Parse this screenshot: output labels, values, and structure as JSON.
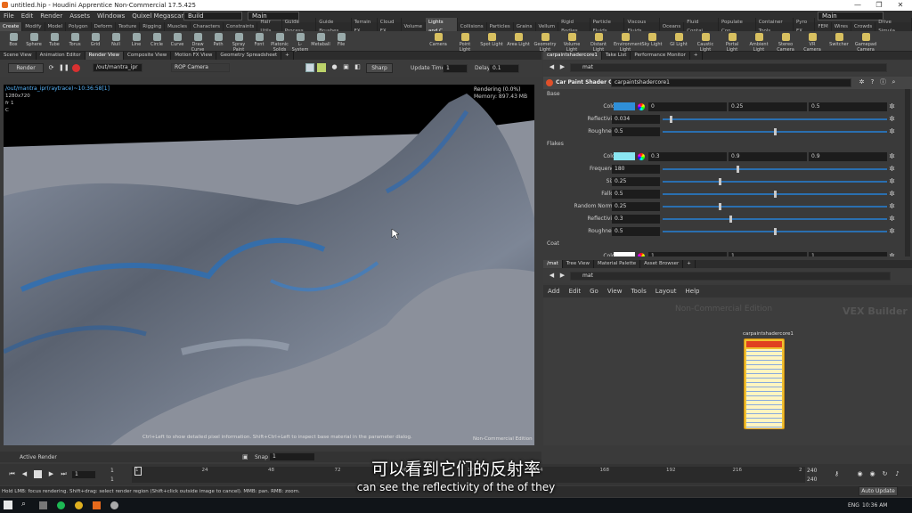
{
  "window": {
    "title": "untitled.hip - Houdini Apprentice Non-Commercial 17.5.425",
    "min": "—",
    "max": "❐",
    "close": "✕"
  },
  "menu": [
    "File",
    "Edit",
    "Render",
    "Assets",
    "Windows",
    "Quixel Megascans",
    "Help"
  ],
  "desktop_combo": "Build",
  "main_combo": "Main",
  "right_main_combo": "Main",
  "shelf_tabs_left": [
    "Create",
    "Modify",
    "Model",
    "Polygon",
    "Deform",
    "Texture",
    "Rigging",
    "Muscles",
    "Characters",
    "Constraints",
    "Hair Utils",
    "Guide Process",
    "Guide Brushes",
    "Terrain FX",
    "Cloud FX",
    "Volume"
  ],
  "shelf_tabs_right": [
    "Lights and C",
    "Collisions",
    "Particles",
    "Grains",
    "Vellum",
    "Rigid Bodies",
    "Particle Fluids",
    "Viscous Fluids",
    "Oceans",
    "Fluid Contai...",
    "Populate Con...",
    "Container Tools",
    "Pyro FX",
    "FEM",
    "Wires",
    "Crowds",
    "Drive Simula..."
  ],
  "shelf_tools_left": [
    "Box",
    "Sphere",
    "Tube",
    "Torus",
    "Grid",
    "Null",
    "Line",
    "Circle",
    "Curve",
    "Draw Curve",
    "Path",
    "Spray Paint",
    "Font",
    "Platonic Solids",
    "L-System",
    "Metaball",
    "File"
  ],
  "shelf_tools_right": [
    "Camera",
    "Point Light",
    "Spot Light",
    "Area Light",
    "Geometry Light",
    "Volume Light",
    "Distant Light",
    "Environment Light",
    "Sky Light",
    "GI Light",
    "Caustic Light",
    "Portal Light",
    "Ambient Light",
    "Stereo Camera",
    "VR Camera",
    "Switcher",
    "Gamepad Camera"
  ],
  "left_pane_tabs": [
    "Scene View",
    "Animation Editor",
    "Render View",
    "Composite View",
    "Motion FX View",
    "Geometry Spreadsheet"
  ],
  "render_toolbar": {
    "render_btn": "Render",
    "path": "/out/mantra_ipr",
    "camera": "ROP Camera",
    "sharp": "Sharp",
    "update_label": "Update Time",
    "update_value": "1",
    "delay_label": "Delay",
    "delay_value": "0.1"
  },
  "render_info": {
    "path": "/out/mantra_ipr(raytrace)~10:36:58[1]",
    "res": "1280x720",
    "frame": "fr 1",
    "channel": "C",
    "status": "Rendering (0.0%)",
    "memory": "Memory:   897.43 MB",
    "hint": "Ctrl+Left to show detailed pixel information. Shift+Ctrl+Left to inspect base material in the parameter dialog.",
    "edition": "Non-Commercial Edition"
  },
  "right_top_tabs": [
    "carpaintshadercore1",
    "Take List",
    "Performance Monitor"
  ],
  "param_path": "mat",
  "param_header": {
    "type": "Car Paint Shader Core",
    "name": "carpaintshadercore1"
  },
  "base_section": "Base",
  "base_params": [
    {
      "label": "Color",
      "v1": "0",
      "v2": "0.25",
      "v3": "0.5",
      "swatch": "#2f8fd8"
    },
    {
      "label": "Reflectivity",
      "value": "0.034",
      "knob": 0.03
    },
    {
      "label": "Roughness",
      "value": "0.5",
      "knob": 0.5
    }
  ],
  "flakes_section": "Flakes",
  "flake_params": [
    {
      "label": "Color",
      "v1": "0.3",
      "v2": "0.9",
      "v3": "0.9",
      "swatch": "#8ae6f2"
    },
    {
      "label": "Frequency",
      "value": "180",
      "knob": 0.33
    },
    {
      "label": "Size",
      "value": "0.25",
      "knob": 0.25
    },
    {
      "label": "Falloff",
      "value": "0.5",
      "knob": 0.5
    },
    {
      "label": "Random Normal",
      "value": "0.25",
      "knob": 0.25
    },
    {
      "label": "Reflectivity",
      "value": "0.3",
      "knob": 0.3
    },
    {
      "label": "Roughness",
      "value": "0.5",
      "knob": 0.5
    }
  ],
  "coat_section": "Coat",
  "coat_params": [
    {
      "label": "Color",
      "v1": "1",
      "v2": "1",
      "v3": "1"
    }
  ],
  "network_tabs": [
    "/mat",
    "Tree View",
    "Material Palette",
    "Asset Browser"
  ],
  "network_path": "mat",
  "network_menu": [
    "Add",
    "Edit",
    "Go",
    "View",
    "Tools",
    "Layout",
    "Help"
  ],
  "network_watermark": "Non-Commercial Edition",
  "network_context": "VEX Builder",
  "node_name": "carpaintshadercore1",
  "timeline": {
    "frame": "1",
    "ticks": [
      "1",
      "24",
      "48",
      "72",
      "96",
      "120",
      "144",
      "168",
      "192",
      "216",
      "2"
    ],
    "start1": "1",
    "start2": "1",
    "end1": "240",
    "end2": "240"
  },
  "bottom_bar": {
    "active_render": "Active Render",
    "snap": "Snap",
    "snap_value": "1"
  },
  "status_text": "Hold LMB: focus rendering. Shift+drag: select render region (Shift+click outside image to cancel). MMB: pan. RMB: zoom.",
  "auto_update": "Auto Update",
  "subtitle_cn": "可以看到它们的反射率",
  "subtitle_en": "can see the reflectivity of the of they",
  "taskbar": {
    "lang": "ENG",
    "time": "10:36 AM"
  },
  "colors": {
    "accent": "#2a6fb0",
    "swatch_base": "#2f8fd8",
    "swatch_flake": "#8ae6f2",
    "node_border": "#f0c030"
  }
}
